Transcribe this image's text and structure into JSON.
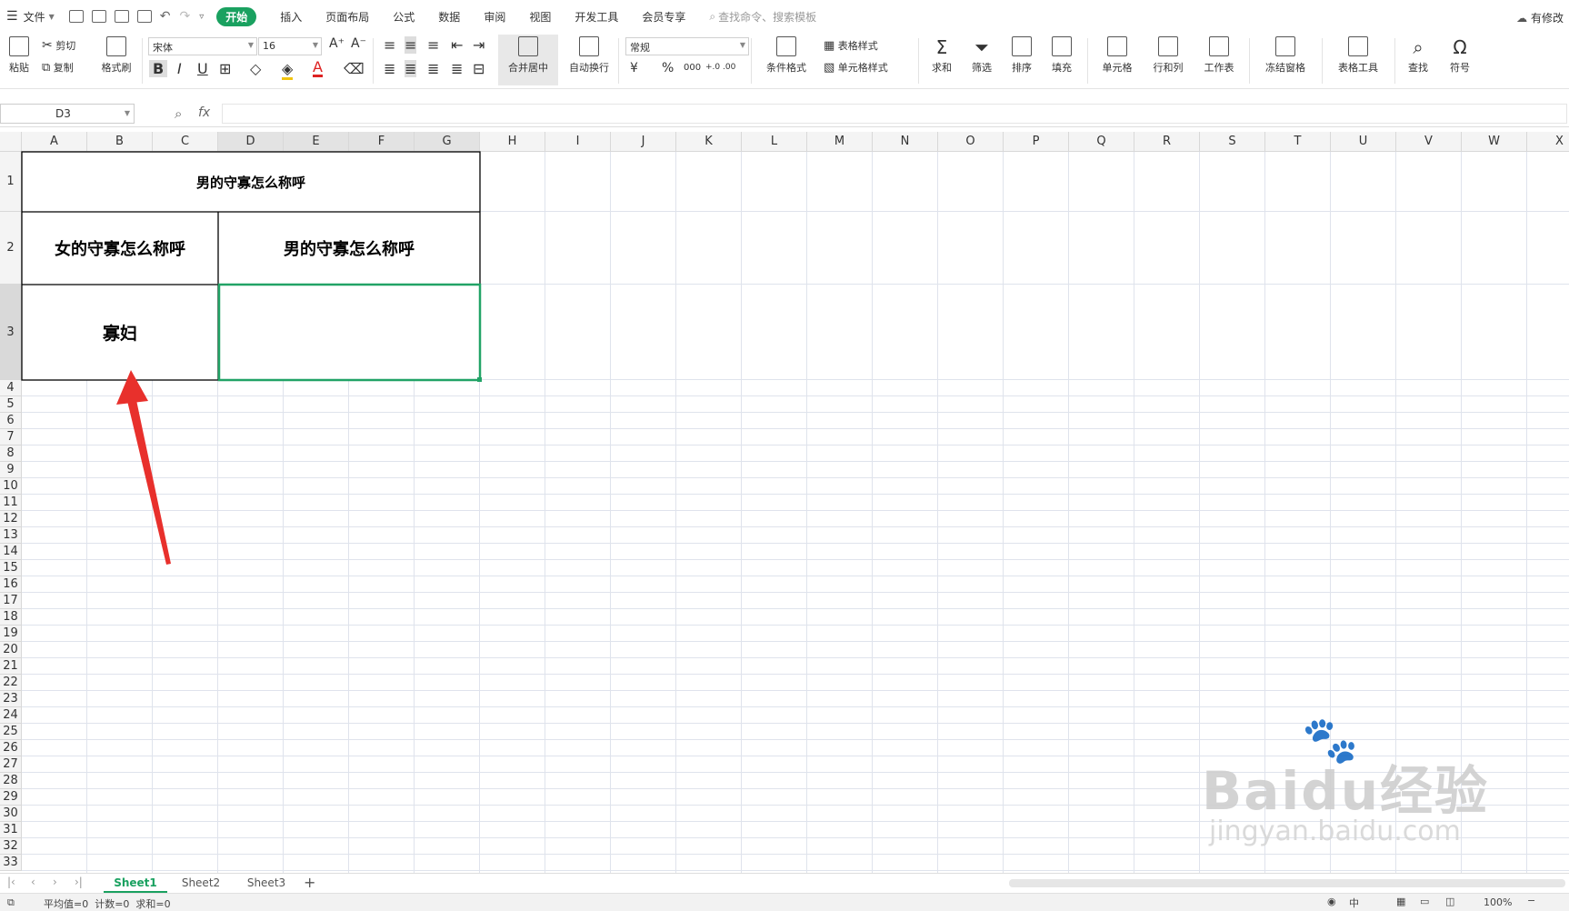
{
  "menu": {
    "file_label": "文件",
    "start_label": "开始",
    "tabs": [
      "插入",
      "页面布局",
      "公式",
      "数据",
      "审阅",
      "视图",
      "开发工具",
      "会员专享"
    ],
    "search_placeholder": "查找命令、搜索模板",
    "right_label": "有修改"
  },
  "ribbon": {
    "paste": "粘贴",
    "cut": "剪切",
    "copy": "复制",
    "format_painter": "格式刷",
    "font_name": "宋体",
    "font_size": "16",
    "merge_center": "合并居中",
    "wrap_text": "自动换行",
    "number_format": "常规",
    "cond_format": "条件格式",
    "table_style": "表格样式",
    "cell_style": "单元格样式",
    "sum": "求和",
    "filter": "筛选",
    "sort": "排序",
    "fill": "填充",
    "cell": "单元格",
    "row_col": "行和列",
    "worksheet": "工作表",
    "freeze": "冻结窗格",
    "table_tools": "表格工具",
    "find": "查找",
    "symbol": "符号",
    "currency": "¥",
    "percent": "%",
    "thousands": "000",
    "inc_decimal": "+.0 .00",
    "dec_decimal": ".00 +.0"
  },
  "formula_bar": {
    "name_box": "D3",
    "fx": "fx",
    "value": ""
  },
  "columns": [
    "A",
    "B",
    "C",
    "D",
    "E",
    "F",
    "G",
    "H",
    "I",
    "J",
    "K",
    "L",
    "M",
    "N",
    "O",
    "P",
    "Q",
    "R",
    "S",
    "T",
    "U",
    "V",
    "W",
    "X"
  ],
  "rows": [
    "1",
    "2",
    "3",
    "4",
    "5",
    "6",
    "7",
    "8",
    "9",
    "10",
    "11",
    "12",
    "13",
    "14",
    "15",
    "16",
    "17",
    "18",
    "19",
    "20",
    "21",
    "22",
    "23",
    "24",
    "25",
    "26",
    "27",
    "28",
    "29",
    "30",
    "31",
    "32",
    "33"
  ],
  "cells": {
    "r1_merged": "男的守寡怎么称呼",
    "r2_left": "女的守寡怎么称呼",
    "r2_right": "男的守寡怎么称呼",
    "r3_left": "寡妇",
    "r3_right": ""
  },
  "sheets": {
    "tabs": [
      "Sheet1",
      "Sheet2",
      "Sheet3"
    ],
    "active": "Sheet1",
    "add": "+"
  },
  "status": {
    "text": "平均值=0  计数=0  求和=0",
    "lang": "中",
    "zoom": "100%"
  },
  "watermark": {
    "brand": "Baidu经验",
    "url": "jingyan.baidu.com"
  },
  "colors": {
    "accent": "#1aa160",
    "selection_border": "#21a366",
    "annotation_arrow": "#e8302c",
    "gridline": "#dfe3ec"
  }
}
